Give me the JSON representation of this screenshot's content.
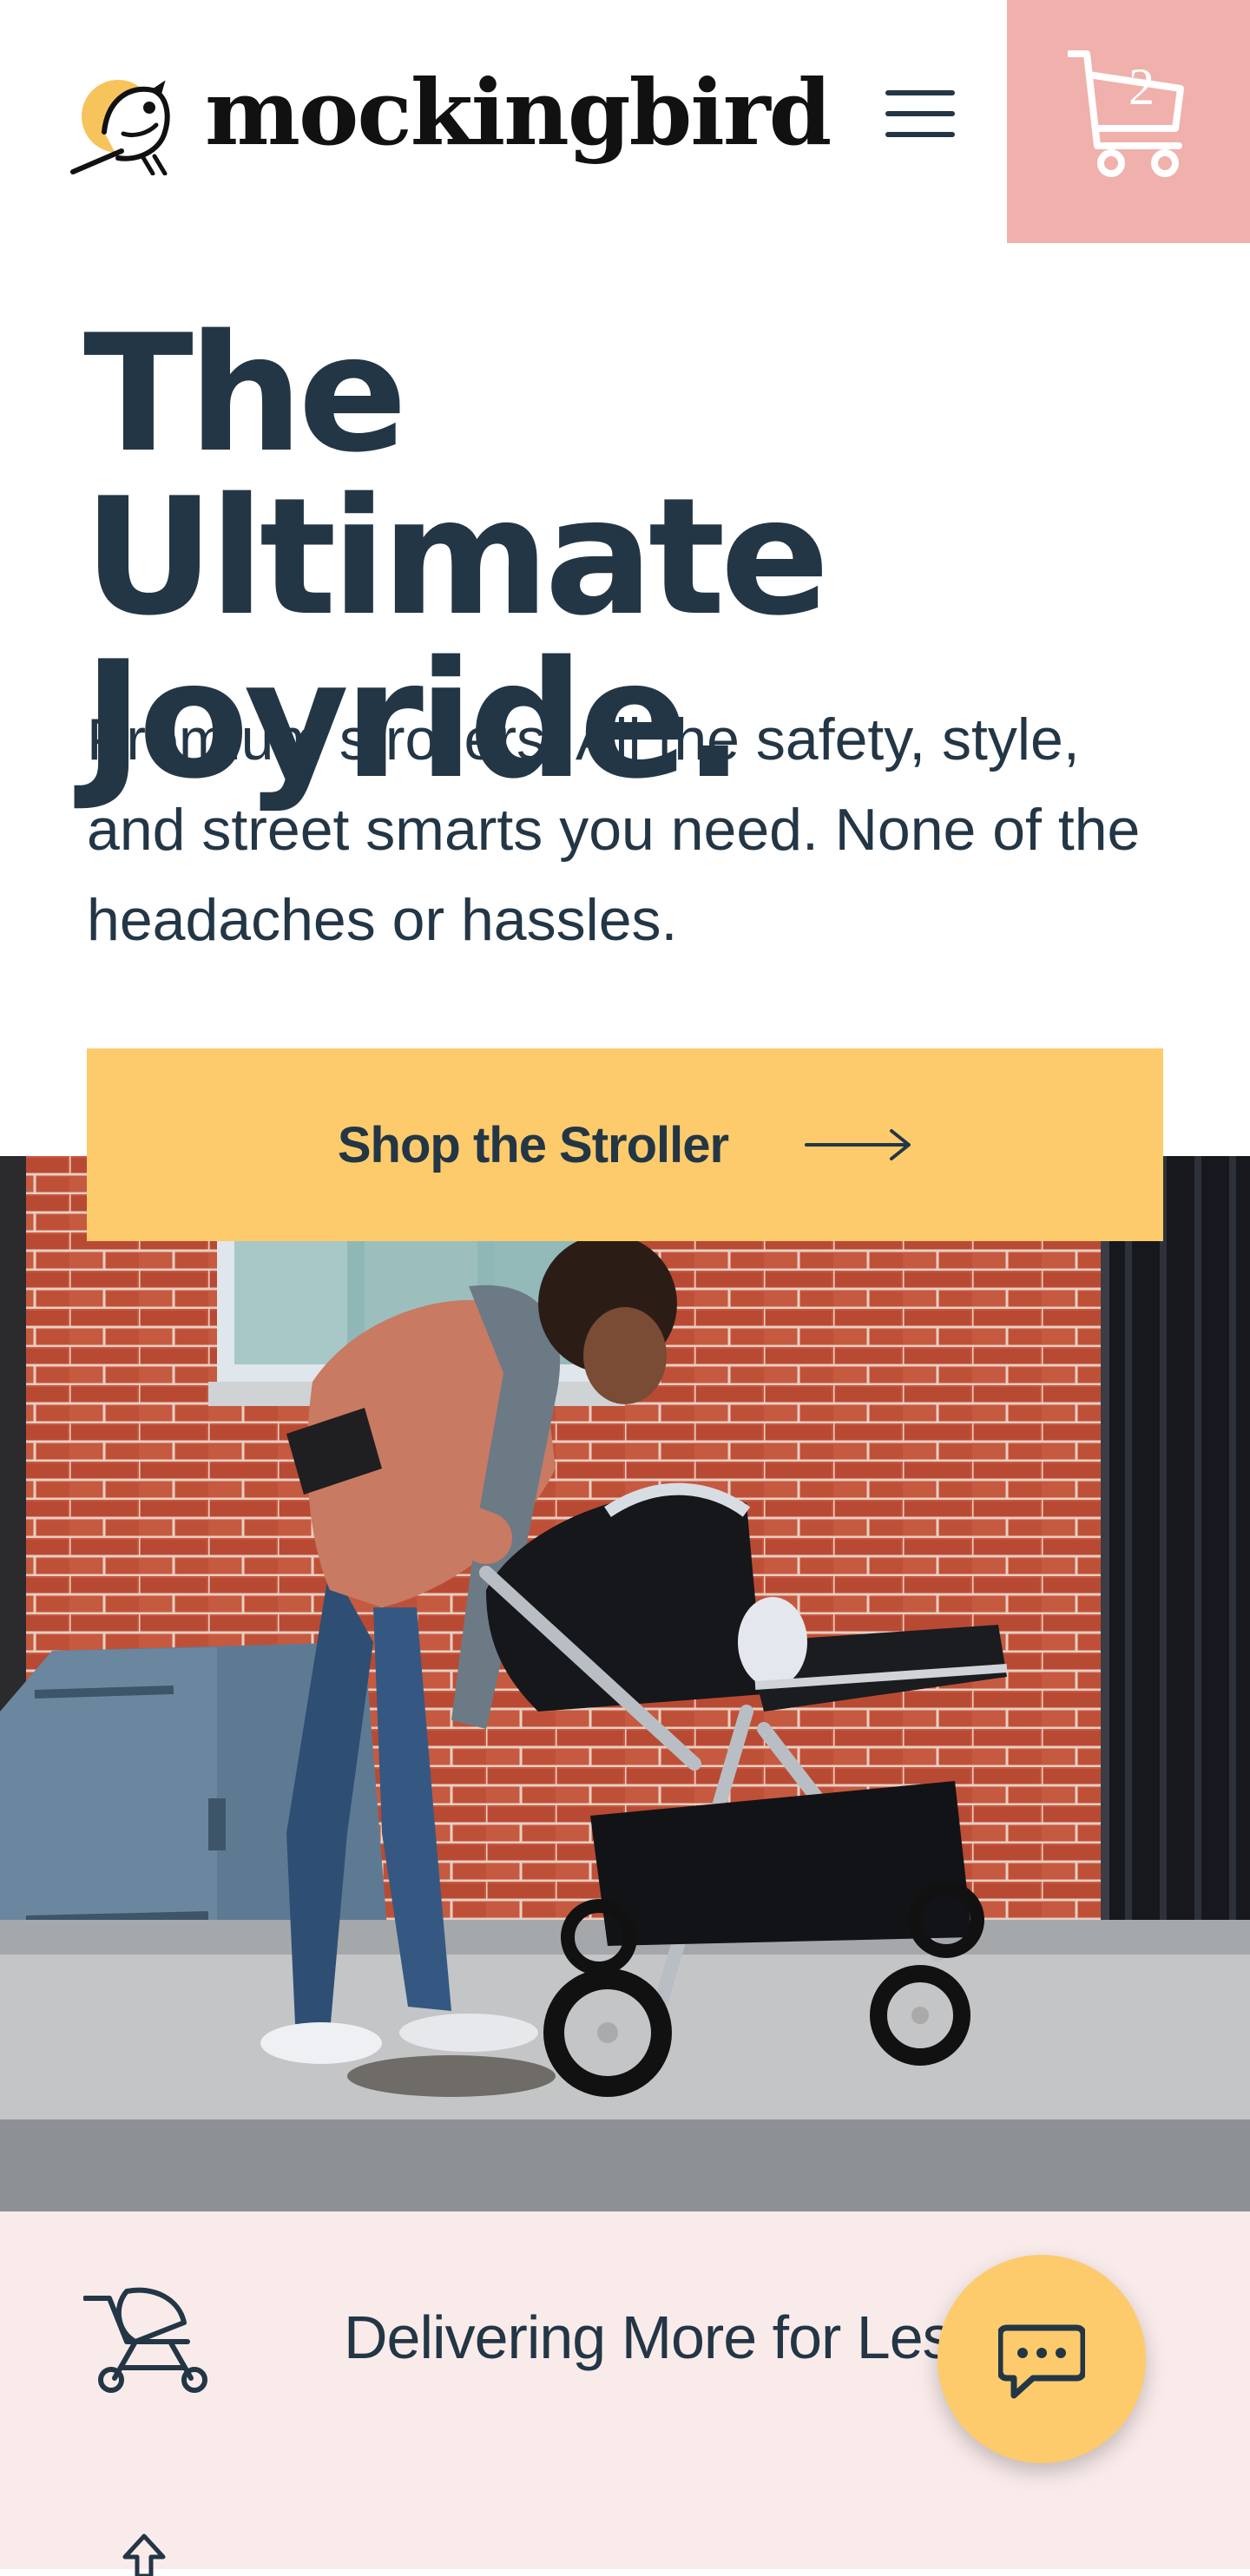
{
  "header": {
    "brand": "mockingbird",
    "cart_count": "2"
  },
  "hero": {
    "headline": "The Ultimate Joyride.",
    "subcopy": "Premium strollers. All the safety, style, and street smarts you need. None of the headaches or hassles.",
    "cta_label": "Shop the Stroller"
  },
  "benefits": {
    "items": [
      {
        "icon": "stroller-icon",
        "label": "Delivering More for Less"
      },
      {
        "icon": "arrow-up-icon",
        "label": ""
      }
    ]
  },
  "colors": {
    "navy": "#233646",
    "cart_bg": "#f0b0ab",
    "cta_bg": "#fdcb6b",
    "benefits_bg": "#f9ebea"
  }
}
